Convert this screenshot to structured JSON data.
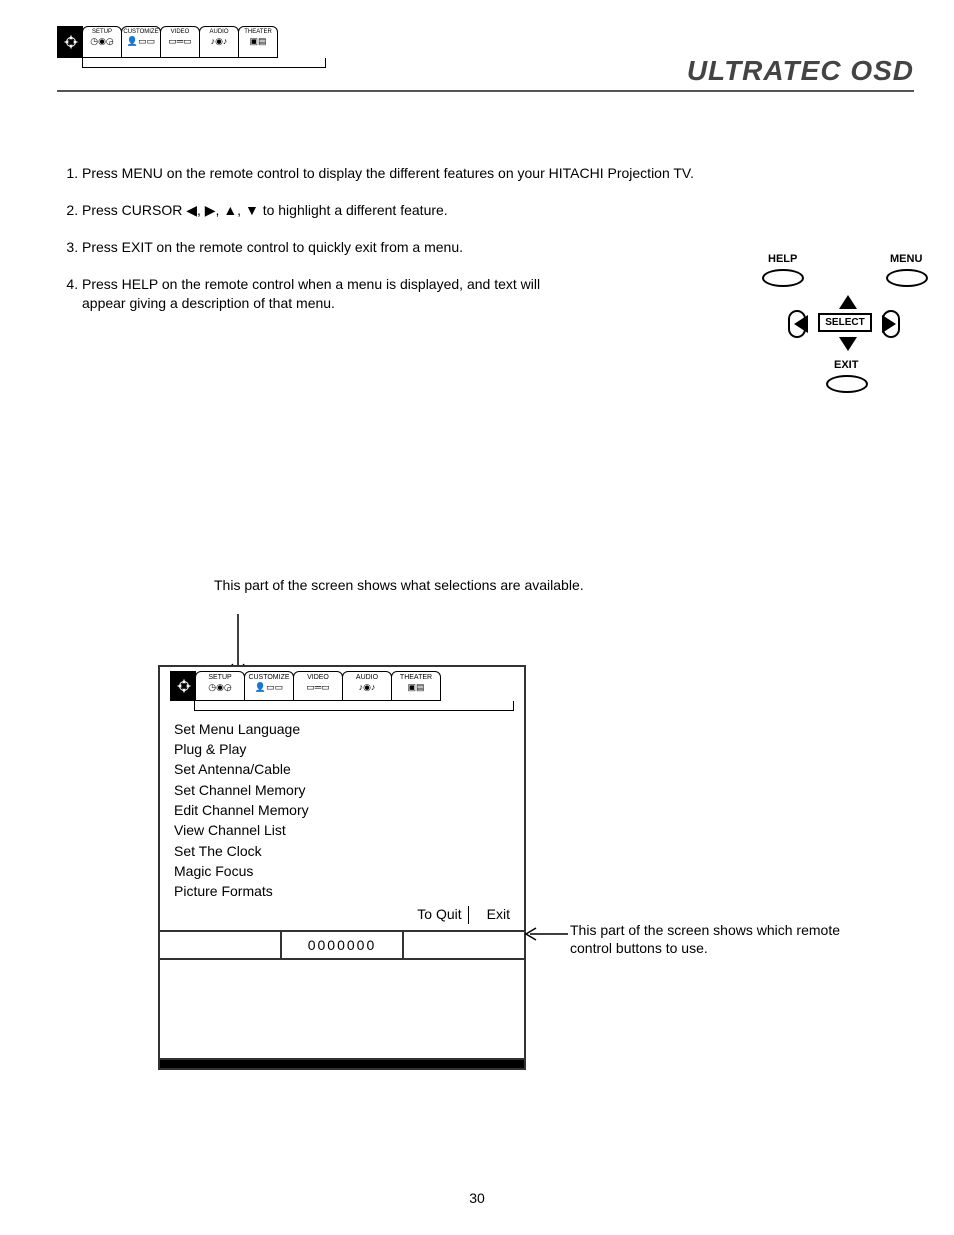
{
  "page_title": "ULTRATEC OSD",
  "page_number": "30",
  "header_tabs": [
    "SETUP",
    "CUSTOMIZE",
    "VIDEO",
    "AUDIO",
    "THEATER"
  ],
  "instructions": [
    "Press MENU on the remote control to display the different features on your HITACHI Projection TV.",
    "Press CURSOR ◀, ▶, ▲, ▼ to highlight a different feature.",
    "Press EXIT on the remote control to quickly exit from a menu.",
    "Press HELP on the remote control when a menu is displayed, and text will appear giving a description of that menu."
  ],
  "remote": {
    "help": "HELP",
    "menu": "MENU",
    "select": "SELECT",
    "exit": "EXIT"
  },
  "diagram": {
    "caption_top": "This part of the screen shows what selections are available.",
    "caption_side": "This part of the screen shows which remote control buttons to use.",
    "tabs": [
      "SETUP",
      "CUSTOMIZE",
      "VIDEO",
      "AUDIO",
      "THEATER"
    ],
    "menu_items": [
      "Set Menu Language",
      "Plug & Play",
      "Set Antenna/Cable",
      "Set Channel Memory",
      "Edit Channel Memory",
      "View Channel List",
      "Set The Clock",
      "Magic Focus",
      "Picture Formats"
    ],
    "to_quit": "To Quit",
    "exit": "Exit",
    "counter": "0000000"
  }
}
